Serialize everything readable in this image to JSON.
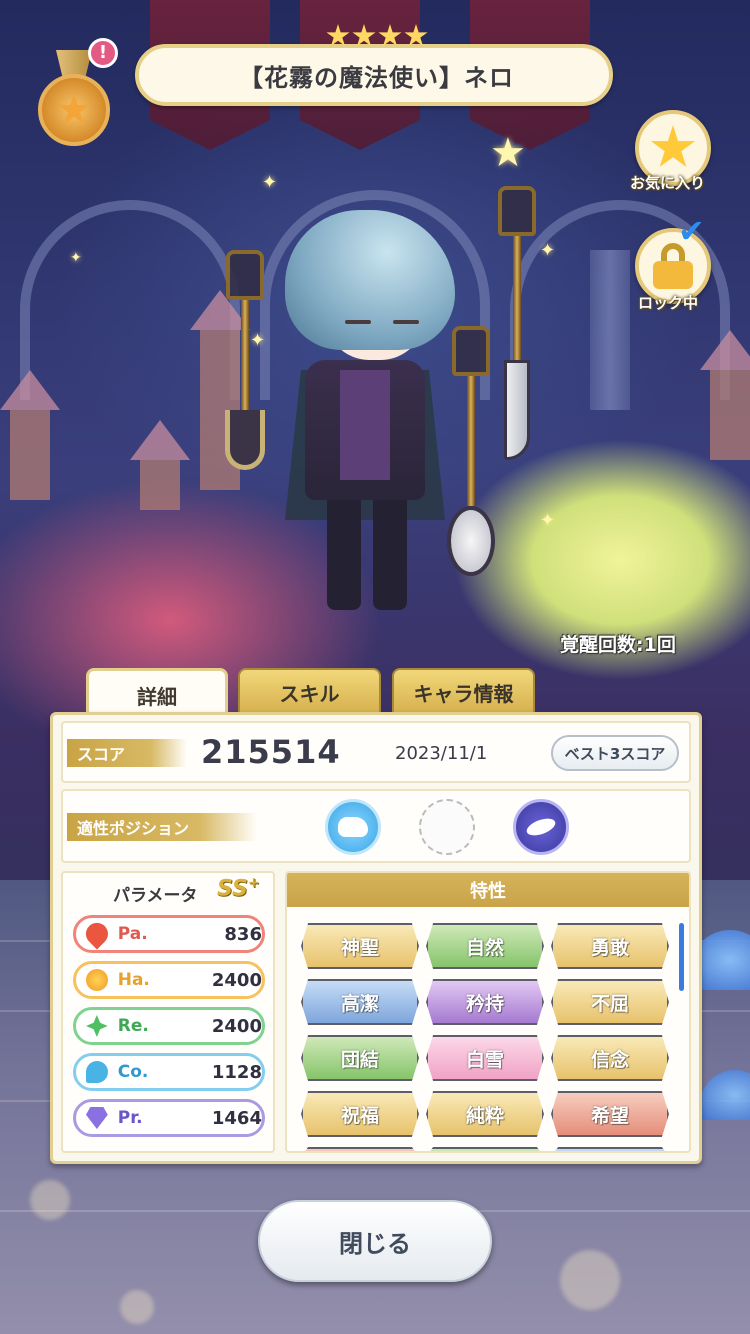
{
  "header": {
    "title": "【花霧の魔法使い】ネロ",
    "rarity_stars": 4,
    "medal_badge": "!"
  },
  "side_buttons": {
    "favorite_label": "お気に入り",
    "lock_label": "ロック中"
  },
  "awaken_count": "覚醒回数:1回",
  "tabs": [
    {
      "label": "詳細",
      "active": true
    },
    {
      "label": "スキル",
      "active": false
    },
    {
      "label": "キャラ情報",
      "active": false
    }
  ],
  "score": {
    "label": "スコア",
    "value": "215514",
    "date": "2023/11/1",
    "best3_button": "ベスト3スコア"
  },
  "positions": {
    "label": "適性ポジション",
    "icons": [
      "cloud-position-icon",
      "empty-position-slot",
      "moon-position-icon"
    ]
  },
  "parameters": {
    "title": "パラメータ",
    "rank": "SS",
    "rank_plus": "+",
    "items": [
      {
        "name": "Pa.",
        "value": "836",
        "icon": "fire-icon",
        "color": "#ea5640"
      },
      {
        "name": "Ha.",
        "value": "2400",
        "icon": "sun-icon",
        "color": "#f09a20"
      },
      {
        "name": "Re.",
        "value": "2400",
        "icon": "clover-icon",
        "color": "#4fbf63"
      },
      {
        "name": "Co.",
        "value": "1128",
        "icon": "wind-icon",
        "color": "#4ab3e6"
      },
      {
        "name": "Pr.",
        "value": "1464",
        "icon": "diamond-icon",
        "color": "#8a70e0"
      }
    ]
  },
  "traits": {
    "title": "特性",
    "items": [
      {
        "label": "神聖",
        "tone": "gold"
      },
      {
        "label": "自然",
        "tone": "green"
      },
      {
        "label": "勇敢",
        "tone": "gold"
      },
      {
        "label": "高潔",
        "tone": "blue"
      },
      {
        "label": "矜持",
        "tone": "purple"
      },
      {
        "label": "不屈",
        "tone": "gold"
      },
      {
        "label": "団結",
        "tone": "green"
      },
      {
        "label": "白雪",
        "tone": "pink"
      },
      {
        "label": "信念",
        "tone": "gold"
      },
      {
        "label": "祝福",
        "tone": "gold"
      },
      {
        "label": "純粋",
        "tone": "gold"
      },
      {
        "label": "希望",
        "tone": "red"
      }
    ]
  },
  "close_button": "閉じる"
}
